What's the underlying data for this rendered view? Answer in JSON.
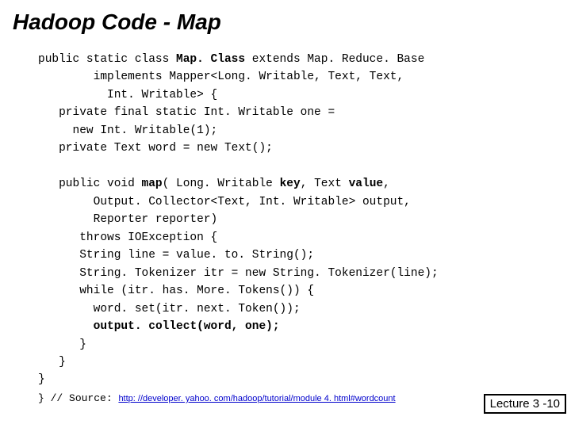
{
  "title": "Hadoop Code - Map",
  "code": {
    "l1a": "public static class ",
    "l1b": "Map. Class",
    "l1c": " extends Map. Reduce. Base",
    "l2": "        implements Mapper<Long. Writable, Text, Text,",
    "l3": "          Int. Writable> {",
    "l4": "   private final static Int. Writable one =",
    "l5": "     new Int. Writable(1);",
    "l6": "   private Text word = new Text();",
    "blank1": "",
    "l7a": "   public void ",
    "l7b": "map",
    "l7c": "( Long. Writable ",
    "l7d": "key",
    "l7e": ", Text ",
    "l7f": "value",
    "l7g": ",",
    "l8": "        Output. Collector<Text, Int. Writable> output,",
    "l9": "        Reporter reporter)",
    "l10": "      throws IOException {",
    "l11": "      String line = value. to. String();",
    "l12": "      String. Tokenizer itr = new String. Tokenizer(line);",
    "l13": "      while (itr. has. More. Tokens()) {",
    "l14": "        word. set(itr. next. Token());",
    "l15a": "        ",
    "l15b": "output. collect(word, one);",
    "l16": "      }",
    "l17": "   }",
    "l18": "}"
  },
  "source": {
    "close_brace": "}",
    "prefix": "  // Source:  ",
    "url_text": "http: //developer. yahoo. com/hadoop/tutorial/module 4. html#wordcount"
  },
  "lecture": "Lecture 3 -10"
}
